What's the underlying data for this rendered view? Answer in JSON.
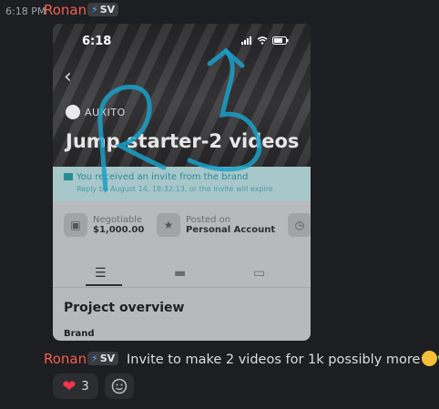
{
  "message1": {
    "timestamp": "6:18 PM",
    "username": "Ronan",
    "badge": "SV",
    "screenshot": {
      "status_time": "6:18",
      "brand": "AUXITO",
      "title": "Jump starter-2 videos",
      "invite_line1": "You received an invite from the brand",
      "invite_line2": "Reply by August 14, 18:32:13, or the invite will expire",
      "cards": [
        {
          "label": "Negotiable",
          "value": "$1,000.00",
          "icon": "money-icon"
        },
        {
          "label": "Posted on",
          "value": "Personal Account",
          "icon": "account-icon"
        }
      ],
      "section_title": "Project overview",
      "field_label": "Brand"
    }
  },
  "message2": {
    "username": "Ronan",
    "badge": "SV",
    "text": "Invite to make 2 videos for 1k possibly more"
  },
  "reactions": [
    {
      "emoji": "heart-icon",
      "count": "3"
    },
    {
      "emoji": "add-reaction-icon",
      "count": ""
    }
  ],
  "colors": {
    "username": "#f0604d",
    "background": "#1d1e22",
    "scribble": "#1aa0c8"
  }
}
